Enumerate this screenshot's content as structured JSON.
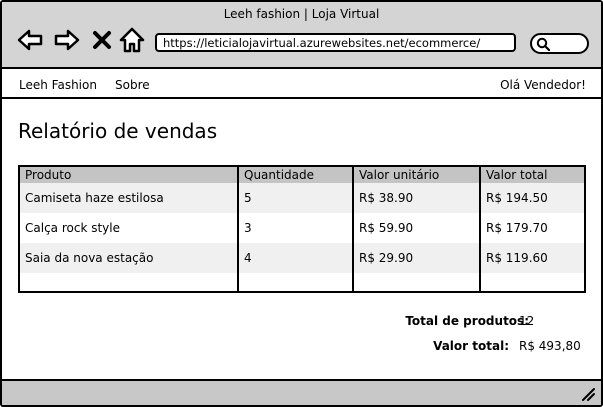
{
  "window": {
    "title": "Leeh fashion | Loja Virtual",
    "url": "https://leticialojavirtual.azurewebsites.net/ecommerce/"
  },
  "icons": [
    "back-arrow-icon",
    "forward-arrow-icon",
    "close-icon",
    "home-icon",
    "search-icon",
    "resize-grip-icon"
  ],
  "menu": {
    "brand": "Leeh Fashion",
    "about": "Sobre",
    "greeting": "Olá Vendedor!"
  },
  "page": {
    "title": "Relatório de vendas"
  },
  "table": {
    "headers": {
      "product": "Produto",
      "quantity": "Quantidade",
      "unit_price": "Valor unitário",
      "total": "Valor total"
    },
    "rows": [
      {
        "product": "Camiseta haze estilosa",
        "quantity": "5",
        "unit_price": "R$ 38.90",
        "total": "R$ 194.50"
      },
      {
        "product": "Calça rock style",
        "quantity": "3",
        "unit_price": "R$ 59.90",
        "total": "R$ 179.70"
      },
      {
        "product": "Saia da nova estação",
        "quantity": "4",
        "unit_price": "R$ 29.90",
        "total": "R$ 119.60"
      }
    ]
  },
  "summary": {
    "products_label": "Total de produtos:",
    "products_value": "12",
    "value_label": "Valor total:",
    "value_value": "R$ 493,80"
  }
}
